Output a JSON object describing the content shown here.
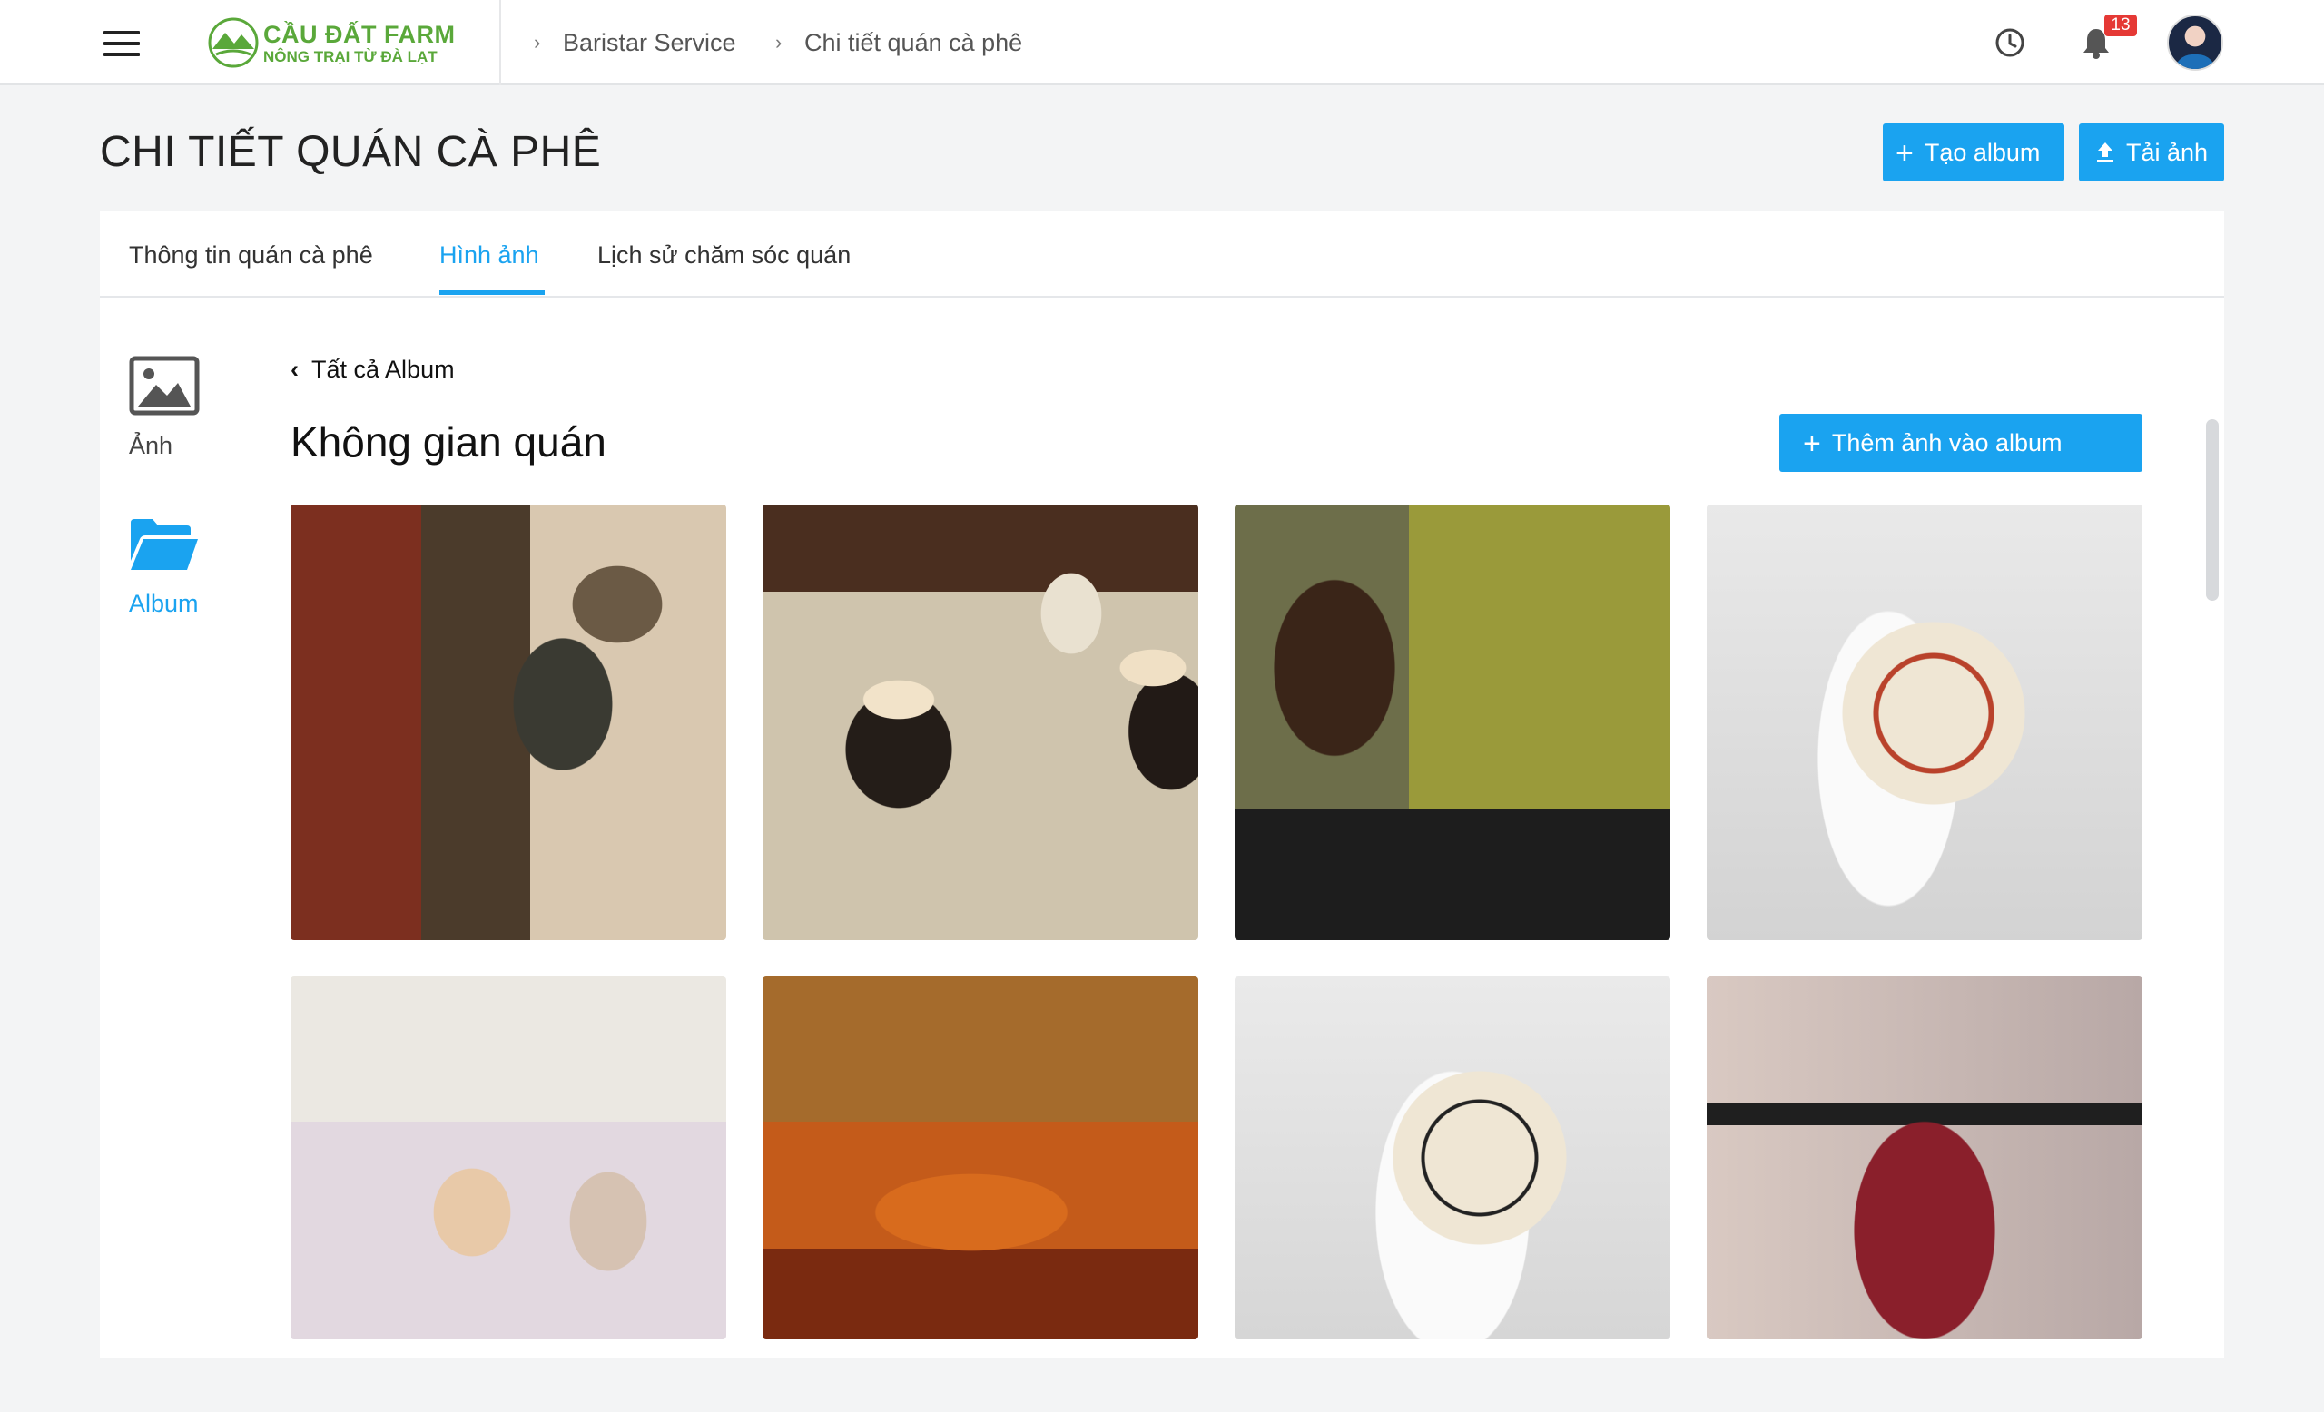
{
  "header": {
    "logo": {
      "title": "CẦU ĐẤT FARM",
      "subtitle": "NÔNG TRẠI TỪ ĐÀ LẠT"
    },
    "breadcrumb": [
      "Baristar Service",
      "Chi tiết quán cà phê"
    ],
    "notification_count": "13",
    "icons": [
      "menu-icon",
      "history-clock-icon",
      "bell-icon",
      "avatar"
    ]
  },
  "page": {
    "title": "CHI TIẾT QUÁN CÀ PHÊ",
    "actions": {
      "create_album": "Tạo album",
      "upload_photo": "Tải ảnh"
    }
  },
  "tabs": [
    "Thông tin quán cà phê",
    "Hình ảnh",
    "Lịch sử chăm sóc quán"
  ],
  "active_tab": "Hình ảnh",
  "side_nav": {
    "photos": "Ảnh",
    "album": "Album",
    "active": "Album"
  },
  "album": {
    "back_label": "Tất cả Album",
    "title": "Không gian quán",
    "add_photo_label": "Thêm ảnh vào album",
    "photo_count_visible": 8
  },
  "colors": {
    "accent": "#1aa3f0",
    "brand_green": "#5aa83a",
    "badge": "#e53935"
  }
}
